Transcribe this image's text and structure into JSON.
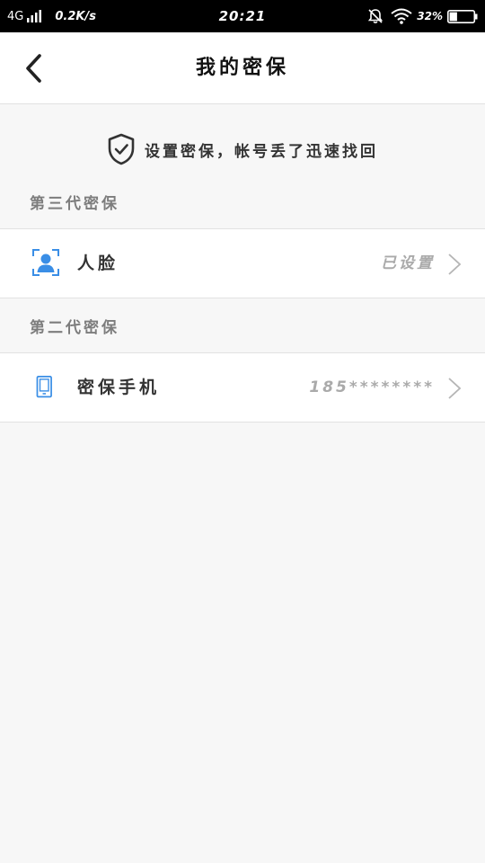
{
  "status_bar": {
    "network": "4G",
    "speed": "0.2K/s",
    "time": "20:21",
    "battery": "32%",
    "battery_level": 0.32,
    "icons": [
      "signal-icon",
      "mute-alarm-icon",
      "wifi-icon",
      "battery-icon"
    ]
  },
  "header": {
    "title": "我的密保",
    "back_icon": "back-arrow-icon"
  },
  "banner": {
    "icon": "shield-check-icon",
    "text": "设置密保，帐号丢了迅速找回"
  },
  "sections": [
    {
      "title": "第三代密保",
      "items": [
        {
          "label": "人脸",
          "value": "已设置",
          "icon": "face-scan-icon"
        }
      ]
    },
    {
      "title": "第二代密保",
      "items": [
        {
          "label": "密保手机",
          "value": "185********",
          "icon": "phone-icon"
        }
      ]
    }
  ],
  "colors": {
    "accent": "#3a8ee6",
    "background": "#f7f7f7",
    "row_background": "#ffffff",
    "muted_text": "#aaaaaa"
  }
}
